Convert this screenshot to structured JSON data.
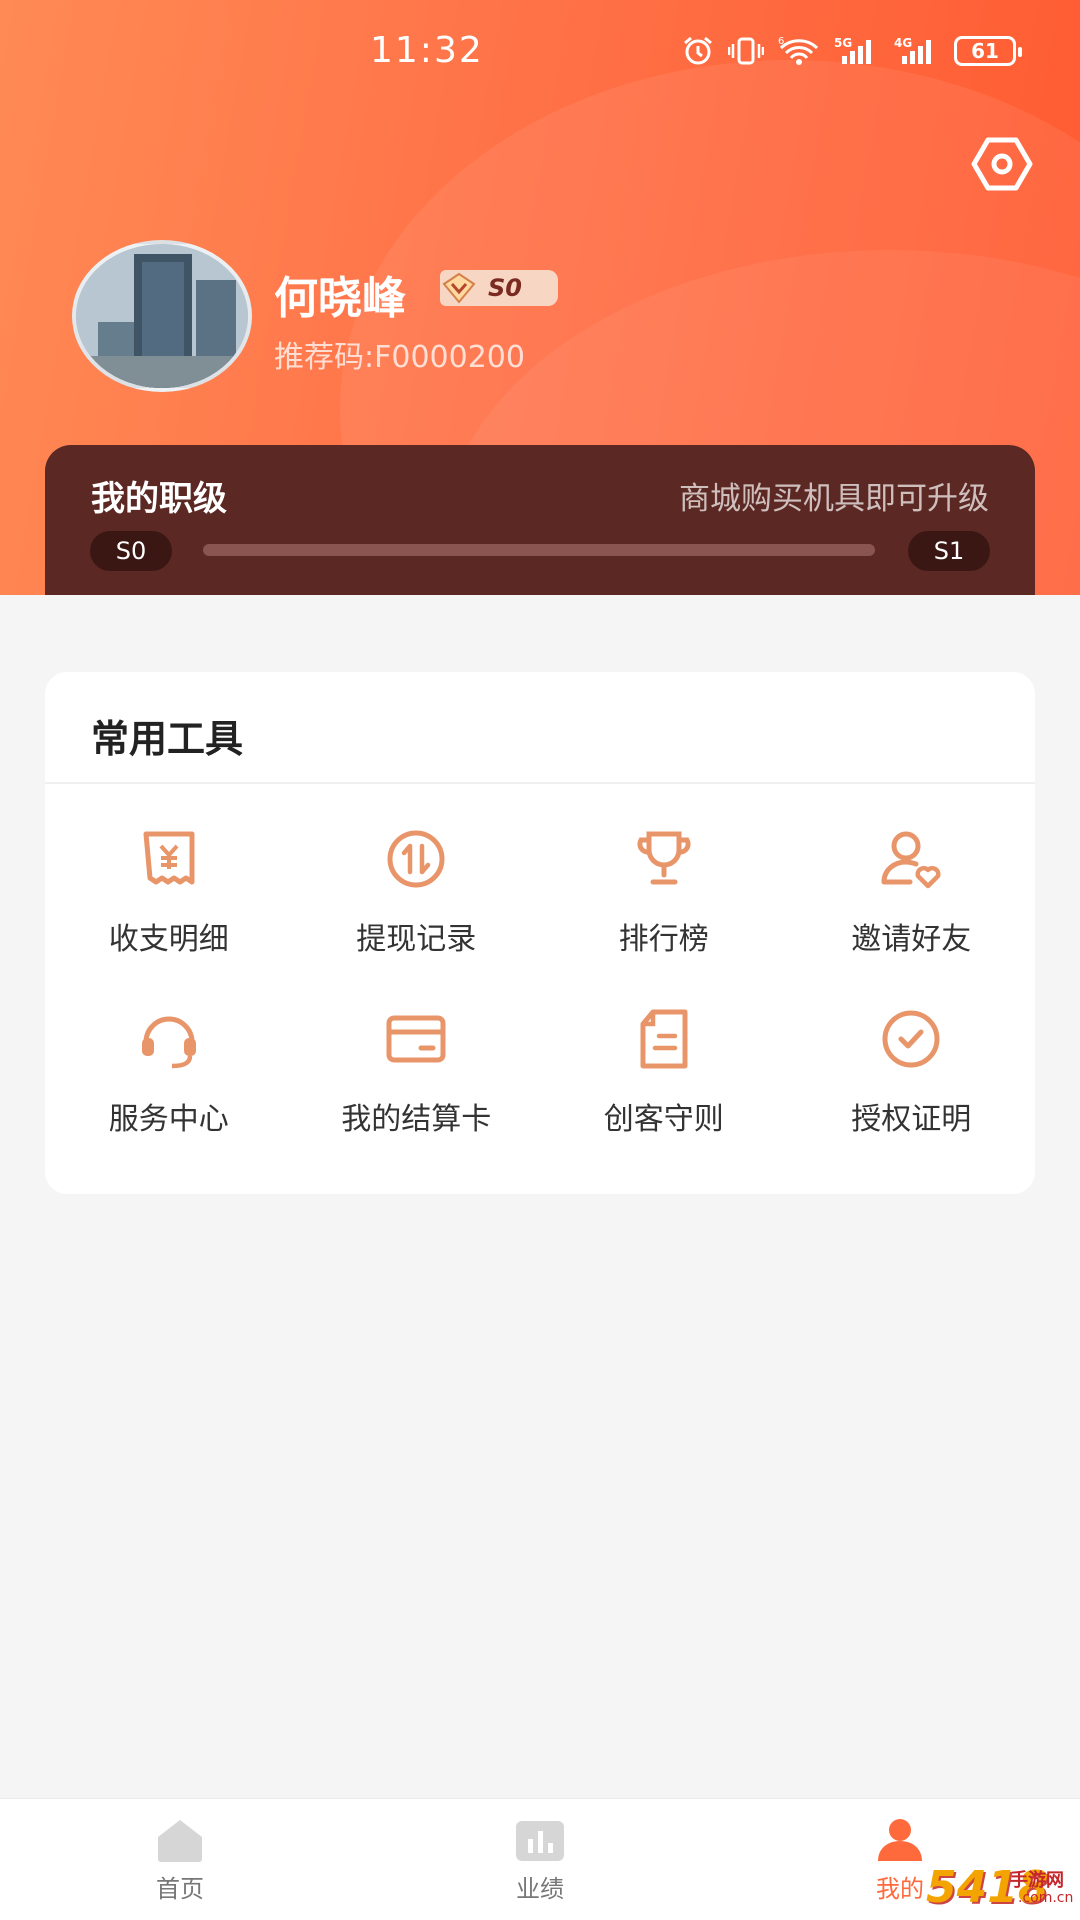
{
  "status_bar": {
    "time": "11:32",
    "battery": "61",
    "net1": "5G",
    "net2": "4G",
    "wifi_badge": "6"
  },
  "profile": {
    "name": "何晓峰",
    "level": "S0",
    "referral": "推荐码:F0000200"
  },
  "rank": {
    "title": "我的职级",
    "hint": "商城购买机具即可升级",
    "current": "S0",
    "next": "S1",
    "progress": 0
  },
  "tools": {
    "title": "常用工具",
    "items": [
      {
        "label": "收支明细",
        "icon": "receipt-yen-icon"
      },
      {
        "label": "提现记录",
        "icon": "exchange-circle-icon"
      },
      {
        "label": "排行榜",
        "icon": "trophy-icon"
      },
      {
        "label": "邀请好友",
        "icon": "user-heart-icon"
      },
      {
        "label": "服务中心",
        "icon": "headset-icon"
      },
      {
        "label": "我的结算卡",
        "icon": "card-icon"
      },
      {
        "label": "创客守则",
        "icon": "document-icon"
      },
      {
        "label": "授权证明",
        "icon": "check-circle-icon"
      }
    ]
  },
  "tabbar": {
    "items": [
      {
        "label": "首页",
        "icon": "home-icon",
        "active": false
      },
      {
        "label": "业绩",
        "icon": "chart-icon",
        "active": false
      },
      {
        "label": "我的",
        "icon": "person-icon",
        "active": true
      }
    ]
  },
  "watermark": {
    "num": "5418",
    "text": "手游网",
    "sub": ".com.cn"
  },
  "colors": {
    "accent": "#ff6a3d",
    "icon": "#e9956a",
    "rank_card": "#5b2824"
  }
}
